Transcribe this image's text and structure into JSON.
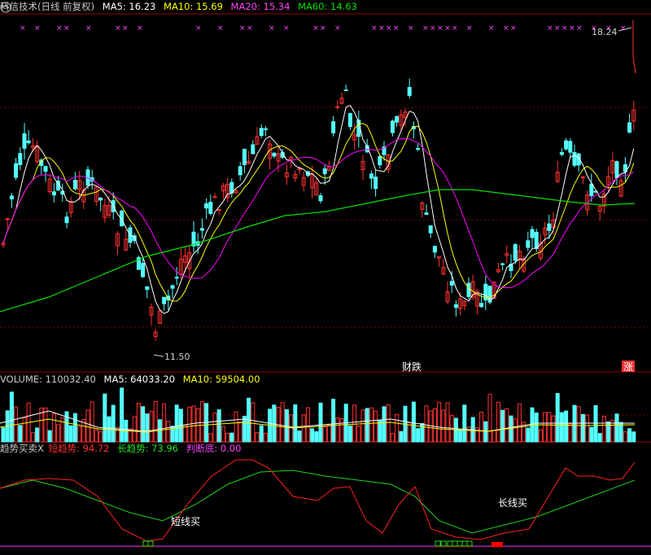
{
  "main_header": {
    "title": "科信技术(日线 前复权)",
    "ma5": "MA5: 16.23",
    "ma10": "MA10: 15.69",
    "ma20": "MA20: 15.34",
    "ma60": "MA60: 14.63"
  },
  "volume_header": {
    "label": "VOLUME: 110032.40",
    "ma5": "MA5: 64033.20",
    "ma10": "MA10: 59504.00"
  },
  "indicator_header": {
    "name": "趋势买卖X",
    "short": "短趋势: 94.72",
    "long": "长趋势: 73.96",
    "bottom": "判断底: 0.00"
  },
  "annotations": {
    "high_price": "18.24",
    "low_price": "11.50",
    "badge_finance": "财",
    "badge_drop": "跌",
    "badge_rise": "涨",
    "short_buy": "短线买",
    "long_buy": "长线买"
  },
  "colors": {
    "up": "#ff3232",
    "down": "#54ffff",
    "ma5": "#ffffff",
    "ma10": "#ffff00",
    "ma20": "#ff00ff",
    "ma60": "#00e000",
    "grid": "#800000",
    "ind_short": "#ff2020",
    "ind_long": "#20d020"
  },
  "icons": {
    "corner": "restore-window-icon"
  }
}
